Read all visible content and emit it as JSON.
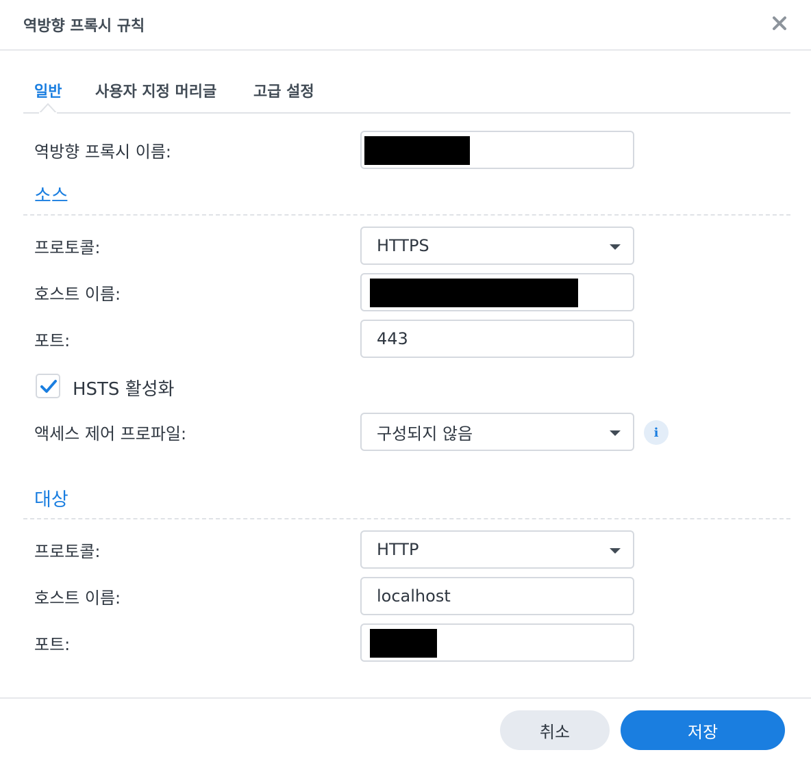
{
  "dialog": {
    "title": "역방향 프록시 규칙",
    "close_icon": "close-icon"
  },
  "tabs": [
    {
      "label": "일반",
      "active": true
    },
    {
      "label": "사용자 지정 머리글",
      "active": false
    },
    {
      "label": "고급 설정",
      "active": false
    }
  ],
  "general": {
    "name_label": "역방향 프록시 이름:",
    "name_value": ""
  },
  "source": {
    "title": "소스",
    "protocol_label": "프로토콜:",
    "protocol_value": "HTTPS",
    "hostname_label": "호스트 이름:",
    "hostname_value": "",
    "port_label": "포트:",
    "port_value": "443",
    "hsts_label": "HSTS 활성화",
    "hsts_checked": true,
    "access_label": "액세스 제어 프로파일:",
    "access_value": "구성되지 않음",
    "info_icon": "info-icon"
  },
  "destination": {
    "title": "대상",
    "protocol_label": "프로토콜:",
    "protocol_value": "HTTP",
    "hostname_label": "호스트 이름:",
    "hostname_value": "localhost",
    "port_label": "포트:",
    "port_value": ""
  },
  "footer": {
    "cancel_label": "취소",
    "save_label": "저장"
  },
  "colors": {
    "accent": "#1a7ee0",
    "text": "#2f3741",
    "border": "#d5d9df"
  }
}
